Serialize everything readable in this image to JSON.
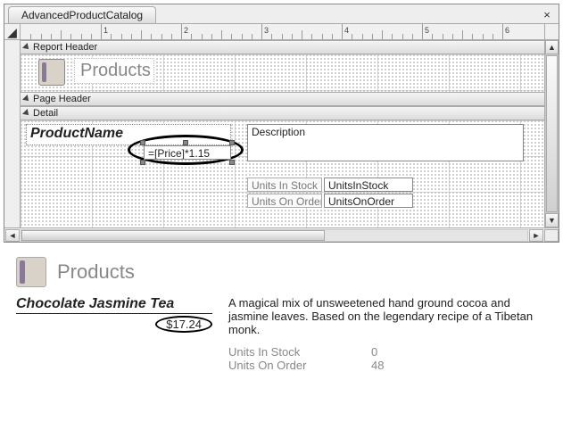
{
  "window": {
    "title": "AdvancedProductCatalog"
  },
  "ruler": {
    "marks": [
      "1",
      "2",
      "3",
      "4",
      "5",
      "6"
    ]
  },
  "sections": {
    "report_header_label": "Report Header",
    "page_header_label": "Page Header",
    "detail_label": "Detail"
  },
  "design": {
    "products_title": "Products",
    "product_name_field": "ProductName",
    "price_expression": "=[Price]*1.15",
    "description_field": "Description",
    "units_in_stock_label": "Units In Stock",
    "units_in_stock_field": "UnitsInStock",
    "units_on_order_label": "Units On Order",
    "units_on_order_field_truncated": "UnitsOnOrder"
  },
  "preview": {
    "title": "Products",
    "product_name": "Chocolate Jasmine Tea",
    "price_display": "$17.24",
    "description": "A magical mix of unsweetened hand ground cocoa and jasmine leaves. Based on the legendary recipe of a Tibetan monk.",
    "units_in_stock_label": "Units In Stock",
    "units_in_stock_value": "0",
    "units_on_order_label": "Units On Order",
    "units_on_order_value": "48"
  }
}
